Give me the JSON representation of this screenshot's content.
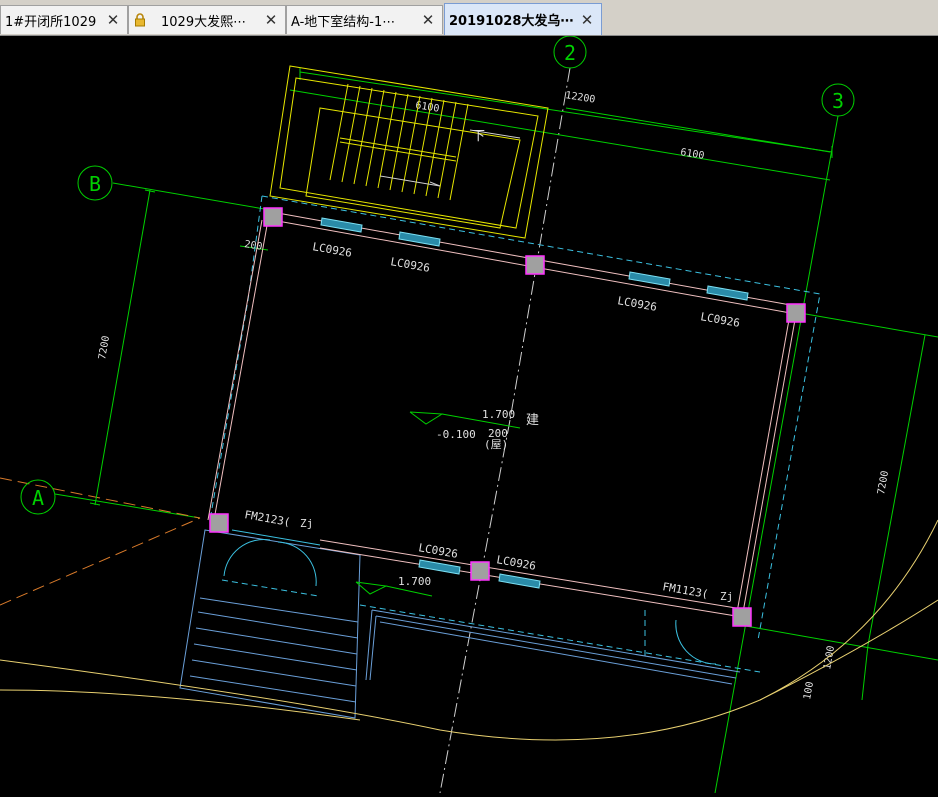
{
  "tabs": [
    {
      "label": "1#开闭所1029",
      "locked": false,
      "active": false
    },
    {
      "label": "1029大发熙⋯",
      "locked": true,
      "active": false
    },
    {
      "label": "A-地下室结构-1⋯",
      "locked": false,
      "active": false
    },
    {
      "label": "20191028大发乌⋯",
      "locked": false,
      "active": true
    }
  ],
  "close_glyph": "✕",
  "drawing": {
    "axes": {
      "a": "A",
      "b": "B",
      "c2": "2",
      "c3": "3"
    },
    "dimensions": {
      "top_total": "12200",
      "stair": "6100",
      "right_span": "6100",
      "left_vertical": "7200",
      "right_vertical": "7200",
      "bottom_right": "1200",
      "bottom_small": "100",
      "wall": "200"
    },
    "windows": [
      "LC0926",
      "LC0926",
      "LC0926",
      "LC0926",
      "LC0926",
      "LC0926"
    ],
    "doors": [
      "FM2123(",
      "FM1123("
    ],
    "door_tags": [
      "Zj",
      "Zj"
    ],
    "elevations": {
      "stair_arrow": "下",
      "roof": "1.700",
      "ground": "-0.100",
      "entry": "1.700"
    },
    "room_text": {
      "main": "建",
      "sub": "200",
      "paren": "(屋)"
    }
  },
  "colors": {
    "axis": "#00d000",
    "yellow": "#e6e600",
    "cyan": "#3bc0e0",
    "wall": "#f0c0c0",
    "column": "#a0a0a0",
    "orange": "#d87a2a"
  }
}
